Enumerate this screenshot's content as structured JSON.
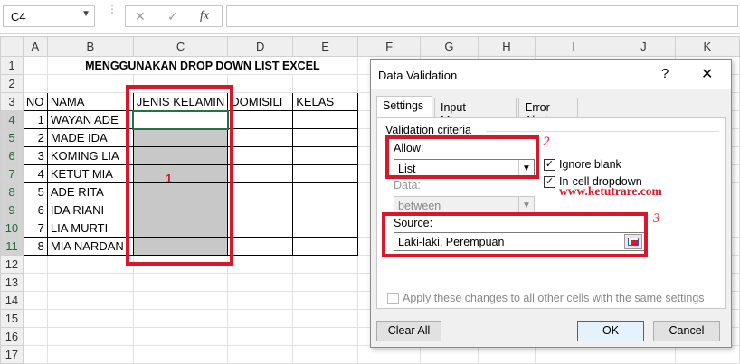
{
  "formula_bar": {
    "name_box": "C4",
    "cancel_glyph": "✕",
    "enter_glyph": "✓",
    "fx_label": "fx",
    "formula_value": ""
  },
  "columns": [
    "A",
    "B",
    "C",
    "D",
    "E",
    "F",
    "G",
    "H",
    "I",
    "J",
    "K"
  ],
  "rows": [
    "1",
    "2",
    "3",
    "4",
    "5",
    "6",
    "7",
    "8",
    "9",
    "10",
    "11",
    "12",
    "13",
    "14",
    "15",
    "16",
    "17"
  ],
  "sheet": {
    "title": "MENGGUNAKAN DROP DOWN LIST EXCEL",
    "headers": {
      "no": "NO",
      "nama": "NAMA",
      "jenis_kelamin": "JENIS KELAMIN",
      "domisili": "DOMISILI",
      "kelas": "KELAS"
    },
    "records": [
      {
        "no": "1",
        "nama": "WAYAN ADE"
      },
      {
        "no": "2",
        "nama": "MADE IDA"
      },
      {
        "no": "3",
        "nama": "KOMING LIA"
      },
      {
        "no": "4",
        "nama": "KETUT MIA"
      },
      {
        "no": "5",
        "nama": "ADE RITA"
      },
      {
        "no": "6",
        "nama": "IDA RIANI"
      },
      {
        "no": "7",
        "nama": "LIA MURTI"
      },
      {
        "no": "8",
        "nama": "MIA NARDAN"
      }
    ]
  },
  "annotations": {
    "mark1": "1",
    "mark2": "2",
    "mark3": "3",
    "website": "www.ketutrare.com",
    "accent_color": "#d6182a"
  },
  "dialog": {
    "title": "Data Validation",
    "help_glyph": "?",
    "close_glyph": "✕",
    "tabs": [
      "Settings",
      "Input Message",
      "Error Alert"
    ],
    "validation_criteria": "Validation criteria",
    "allow_label": "Allow:",
    "allow_value": "List",
    "ignore_blank": "Ignore blank",
    "in_cell_dropdown": "In-cell dropdown",
    "data_label": "Data:",
    "data_value": "between",
    "source_label": "Source:",
    "source_value": "Laki-laki, Perempuan",
    "apply_all": "Apply these changes to all other cells with the same settings",
    "clear_all": "Clear All",
    "ok": "OK",
    "cancel": "Cancel"
  }
}
